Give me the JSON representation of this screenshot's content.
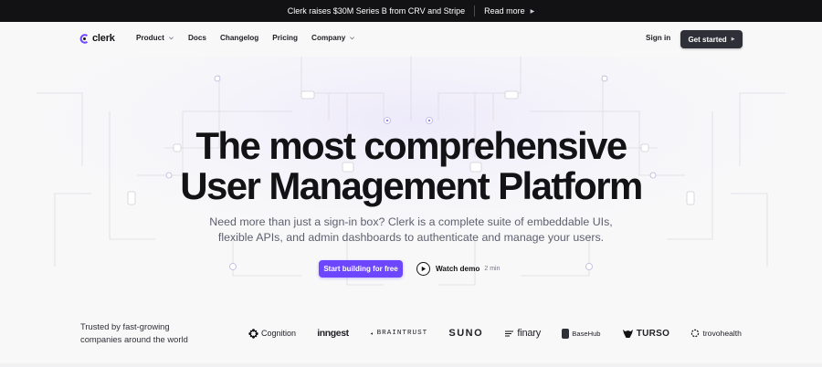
{
  "announcement": {
    "message": "Clerk raises $30M Series B from CRV and Stripe",
    "link_label": "Read more"
  },
  "header": {
    "logo_text": "clerk",
    "nav": [
      {
        "label": "Product",
        "has_dropdown": true
      },
      {
        "label": "Docs",
        "has_dropdown": false
      },
      {
        "label": "Changelog",
        "has_dropdown": false
      },
      {
        "label": "Pricing",
        "has_dropdown": false
      },
      {
        "label": "Company",
        "has_dropdown": true
      }
    ],
    "signin_label": "Sign in",
    "cta_label": "Get started"
  },
  "hero": {
    "title_line1": "The most comprehensive",
    "title_line2": "User Management Platform",
    "subtitle_line1": "Need more than just a sign-in box? Clerk is a complete suite of embeddable UIs,",
    "subtitle_line2": "flexible APIs, and admin dashboards to authenticate and manage your users.",
    "primary_cta": "Start building for free",
    "watch_label": "Watch demo",
    "watch_duration": "2 min"
  },
  "trusted": {
    "line1": "Trusted by fast-growing",
    "line2": "companies around the world",
    "logos": [
      "Cognition",
      "inngest",
      "BRAINTRUST",
      "SUNO",
      "finary",
      "BaseHub",
      "TURSO",
      "trovohealth"
    ]
  },
  "colors": {
    "accent": "#6c47ff",
    "announcement_bg": "#121214",
    "button_dark": "#2f3037",
    "background": "#f8f8f9",
    "text": "#131316",
    "muted_text": "#5e5f6e"
  }
}
